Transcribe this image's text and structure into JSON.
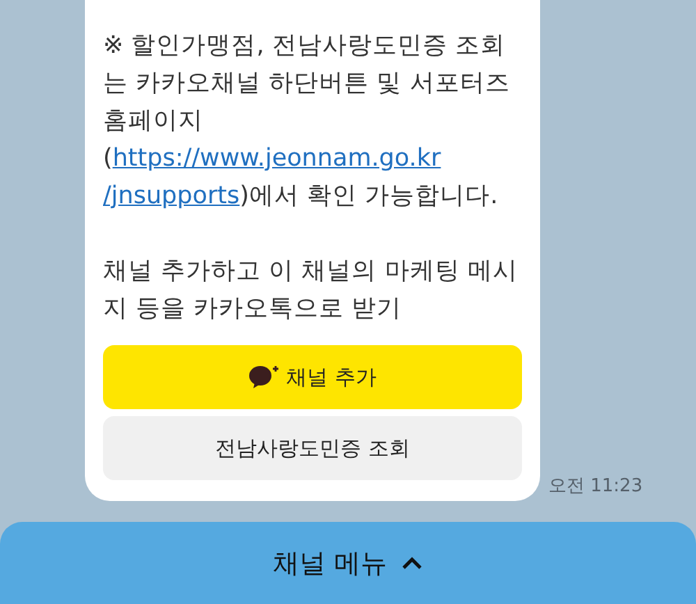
{
  "message": {
    "notice_before": "※ 할인가맹점, 전남사랑도민증 조회는 카카오채널 하단버튼 및 서포터즈 홈페이지",
    "open_paren": "(",
    "link_parts": [
      "https://www.jeonnam.go.kr",
      "/jnsupports"
    ],
    "notice_after": ")에서 확인 가능합니다.",
    "invite": "채널 추가하고 이 채널의 마케팅 메시지 등을 카카오톡으로 받기",
    "buttons": [
      {
        "kind": "add_channel",
        "label": "채널 추가"
      },
      {
        "kind": "plain",
        "label": "전남사랑도민증 조회"
      }
    ],
    "time": "오전 11:23"
  },
  "channel_menu": {
    "label": "채널 메뉴",
    "expanded": false
  }
}
